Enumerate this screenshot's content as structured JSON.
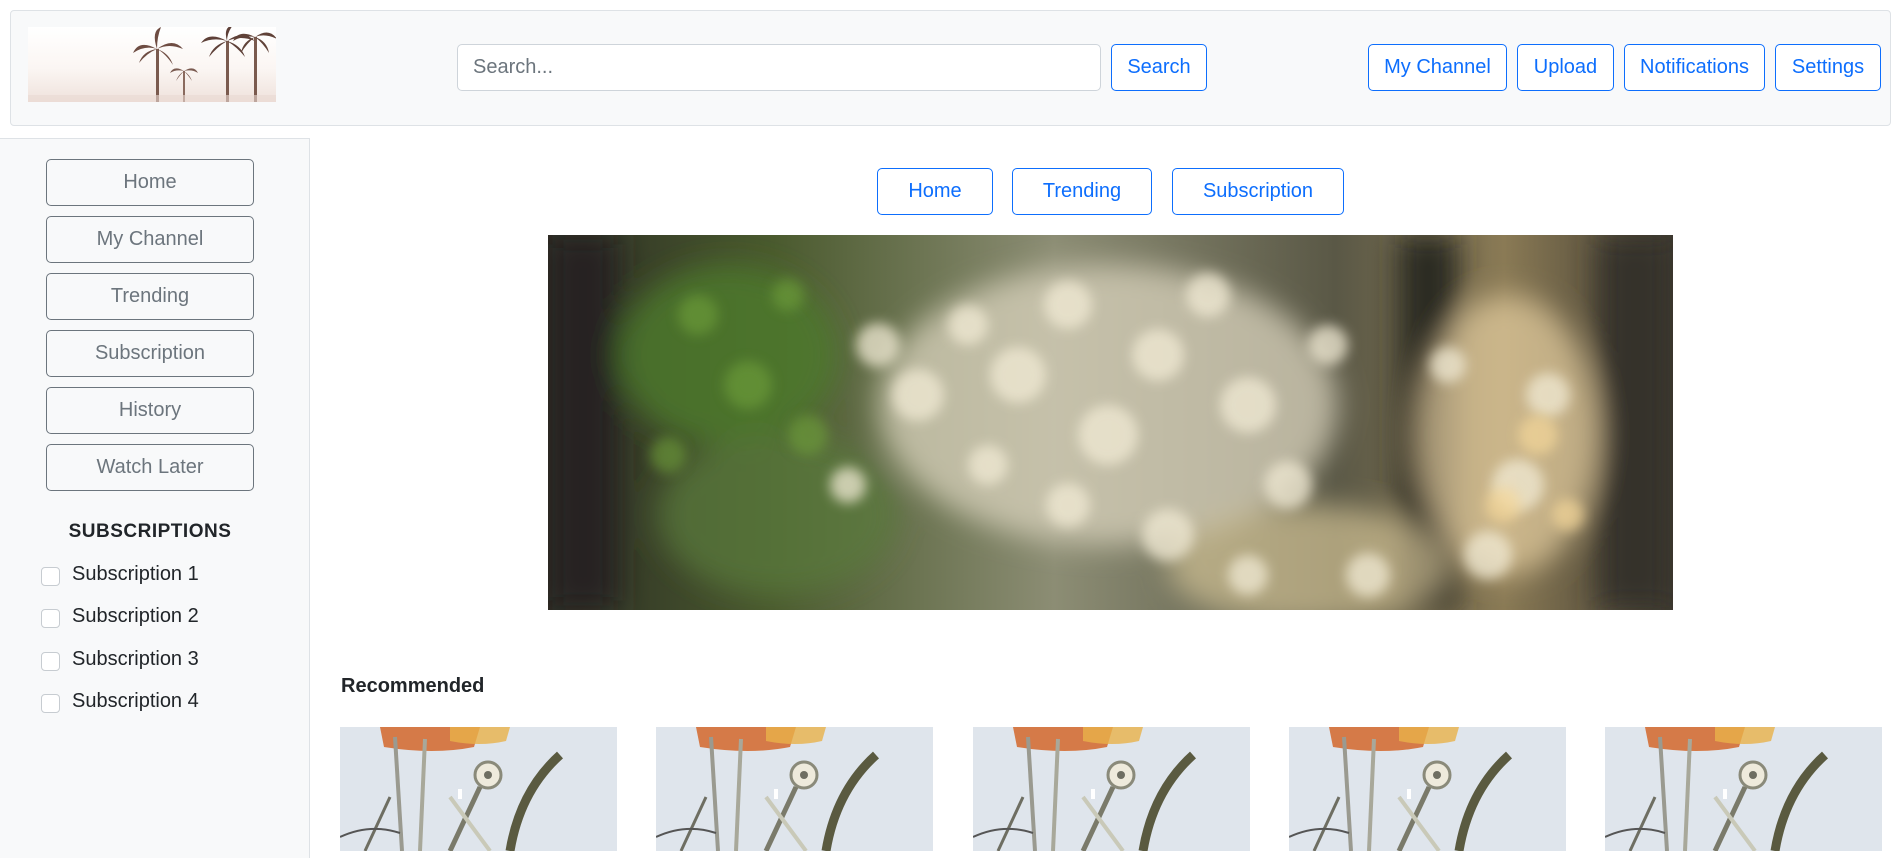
{
  "header": {
    "logo_alt": "palm trees logo",
    "search": {
      "placeholder": "Search...",
      "value": ""
    },
    "search_button": "Search",
    "nav": [
      "My Channel",
      "Upload",
      "Notifications",
      "Settings"
    ]
  },
  "sidebar": {
    "items": [
      "Home",
      "My Channel",
      "Trending",
      "Subscription",
      "History",
      "Watch Later"
    ],
    "subscriptions_title": "SUBSCRIPTIONS",
    "subscriptions": [
      {
        "label": "Subscription 1",
        "checked": false
      },
      {
        "label": "Subscription 2",
        "checked": false
      },
      {
        "label": "Subscription 3",
        "checked": false
      },
      {
        "label": "Subscription 4",
        "checked": false
      }
    ]
  },
  "main": {
    "tabs": [
      "Home",
      "Trending",
      "Subscription"
    ],
    "banner_alt": "blurred forest bokeh",
    "recommended_title": "Recommended",
    "video_count": 5
  },
  "colors": {
    "accent": "#0d6efd",
    "muted": "#6c757d",
    "panel_bg": "#f8f9fa",
    "border": "#dee2e6"
  }
}
